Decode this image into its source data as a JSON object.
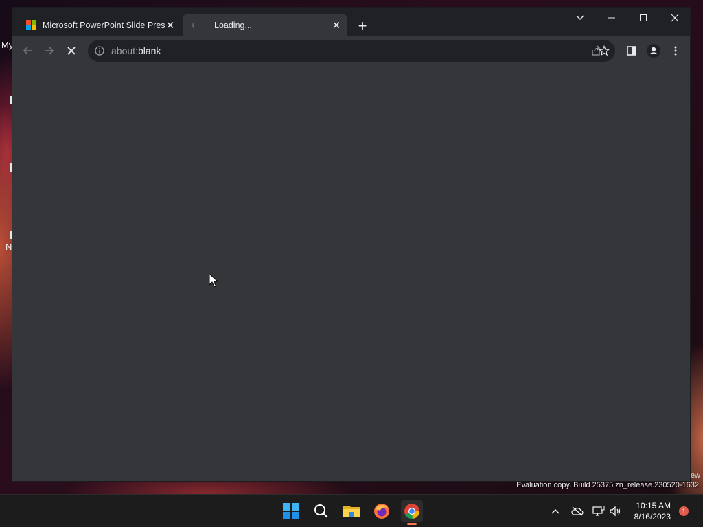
{
  "desktop": {
    "fragments": [
      "My",
      "N"
    ],
    "watermark": "Evaluation copy. Build 25375.zn_release.230520-1632",
    "watermark_fragment": "ew"
  },
  "browser": {
    "tabs": [
      {
        "title": "Microsoft PowerPoint Slide Prese",
        "favicon": "microsoft-logo",
        "active": false
      },
      {
        "title": "Loading...",
        "favicon": "loading-spinner",
        "active": true
      }
    ],
    "new_tab_symbol": "+",
    "address_bar": {
      "url_prefix": "about:",
      "url_host": "blank"
    },
    "colors": {
      "frame": "#202124",
      "toolbar": "#35363a",
      "omnibox": "#202124",
      "content": "#35363a"
    }
  },
  "taskbar": {
    "apps": [
      "windows-start-icon",
      "search-icon",
      "file-explorer-icon",
      "firefox-icon",
      "chrome-icon"
    ],
    "clock": {
      "time": "10:15 AM",
      "date": "8/16/2023"
    },
    "notification_count": "1"
  }
}
